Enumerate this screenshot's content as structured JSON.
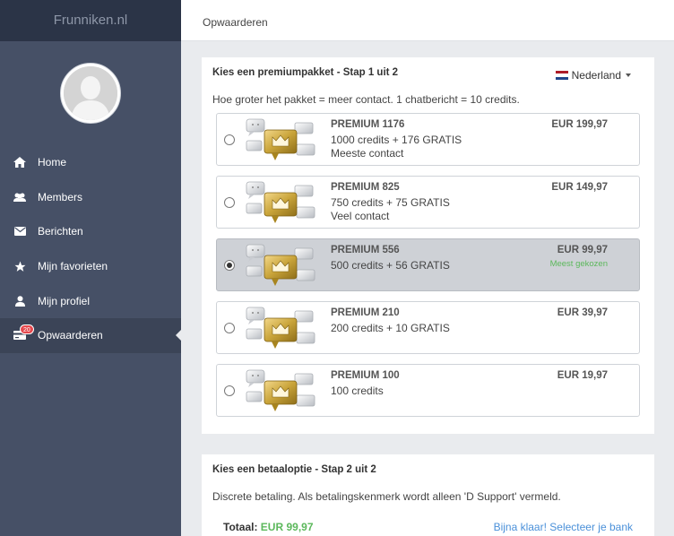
{
  "brand": "Frunniken.nl",
  "sidebar": {
    "items": [
      {
        "label": "Home",
        "icon": "home-icon"
      },
      {
        "label": "Members",
        "icon": "users-icon"
      },
      {
        "label": "Berichten",
        "icon": "envelope-icon"
      },
      {
        "label": "Mijn favorieten",
        "icon": "star-icon"
      },
      {
        "label": "Mijn profiel",
        "icon": "user-icon"
      },
      {
        "label": "Opwaarderen",
        "icon": "credit-card-icon",
        "badge": "20",
        "active": true
      }
    ]
  },
  "topbar": {
    "title": "Opwaarderen"
  },
  "step1": {
    "title": "Kies een premiumpakket - Stap 1 uit 2",
    "subtitle": "Hoe groter het pakket = meer contact. 1 chatbericht = 10 credits.",
    "language": "Nederland",
    "packages": [
      {
        "name": "PREMIUM 1176",
        "line1": "1000 credits + 176 GRATIS",
        "line2": "Meeste contact",
        "price": "EUR 199,97",
        "tag": "",
        "selected": false
      },
      {
        "name": "PREMIUM 825",
        "line1": "750 credits + 75 GRATIS",
        "line2": "Veel contact",
        "price": "EUR 149,97",
        "tag": "",
        "selected": false
      },
      {
        "name": "PREMIUM 556",
        "line1": "500 credits + 56 GRATIS",
        "line2": "",
        "price": "EUR 99,97",
        "tag": "Meest gekozen",
        "selected": true
      },
      {
        "name": "PREMIUM 210",
        "line1": "200 credits + 10 GRATIS",
        "line2": "",
        "price": "EUR 39,97",
        "tag": "",
        "selected": false
      },
      {
        "name": "PREMIUM 100",
        "line1": "100 credits",
        "line2": "",
        "price": "EUR 19,97",
        "tag": "",
        "selected": false
      }
    ]
  },
  "step2": {
    "title": "Kies een betaaloptie - Stap 2 uit 2",
    "subtitle": "Discrete betaling. Als betalingskenmerk wordt alleen 'D Support' vermeld.",
    "total_label": "Totaal:",
    "total_value": "EUR 99,97",
    "link": "Bijna klaar! Selecteer je bank"
  },
  "colors": {
    "sidebar": "#465066",
    "brand_bar": "#2b3447",
    "accent_green": "#5cb85c",
    "link_blue": "#4a90d9",
    "selected_row": "#ced1d6"
  }
}
